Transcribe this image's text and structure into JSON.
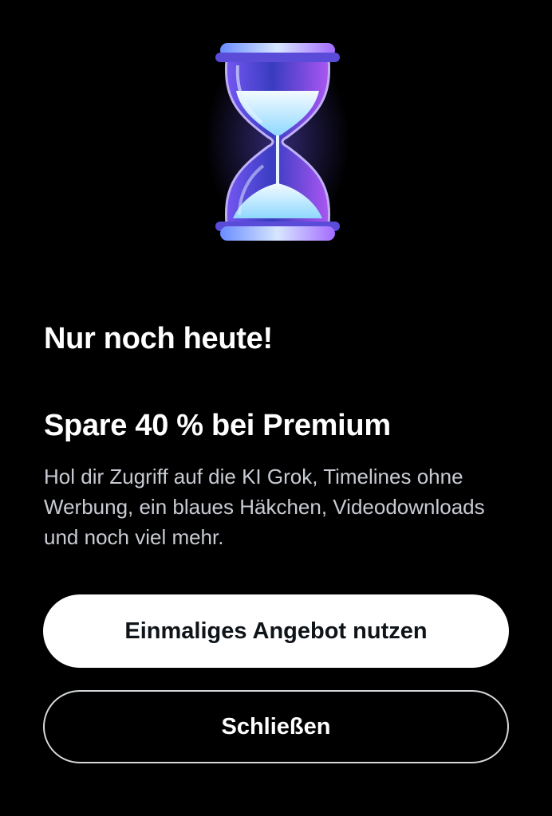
{
  "hero": {
    "icon": "hourglass-icon"
  },
  "promo": {
    "headline": "Nur noch heute!",
    "offer_title": "Spare 40 % bei Premium",
    "offer_description": "Hol dir Zugriff auf die KI Grok, Timelines ohne Werbung, ein blaues Häkchen, Videodownloads und noch viel mehr."
  },
  "actions": {
    "primary_label": "Einmaliges Angebot nutzen",
    "secondary_label": "Schließen"
  },
  "colors": {
    "background": "#000000",
    "primary_button_bg": "#ffffff",
    "primary_button_text": "#0f1419",
    "description_text": "#c8ccd2",
    "hourglass_glow": "#8a6cff"
  }
}
